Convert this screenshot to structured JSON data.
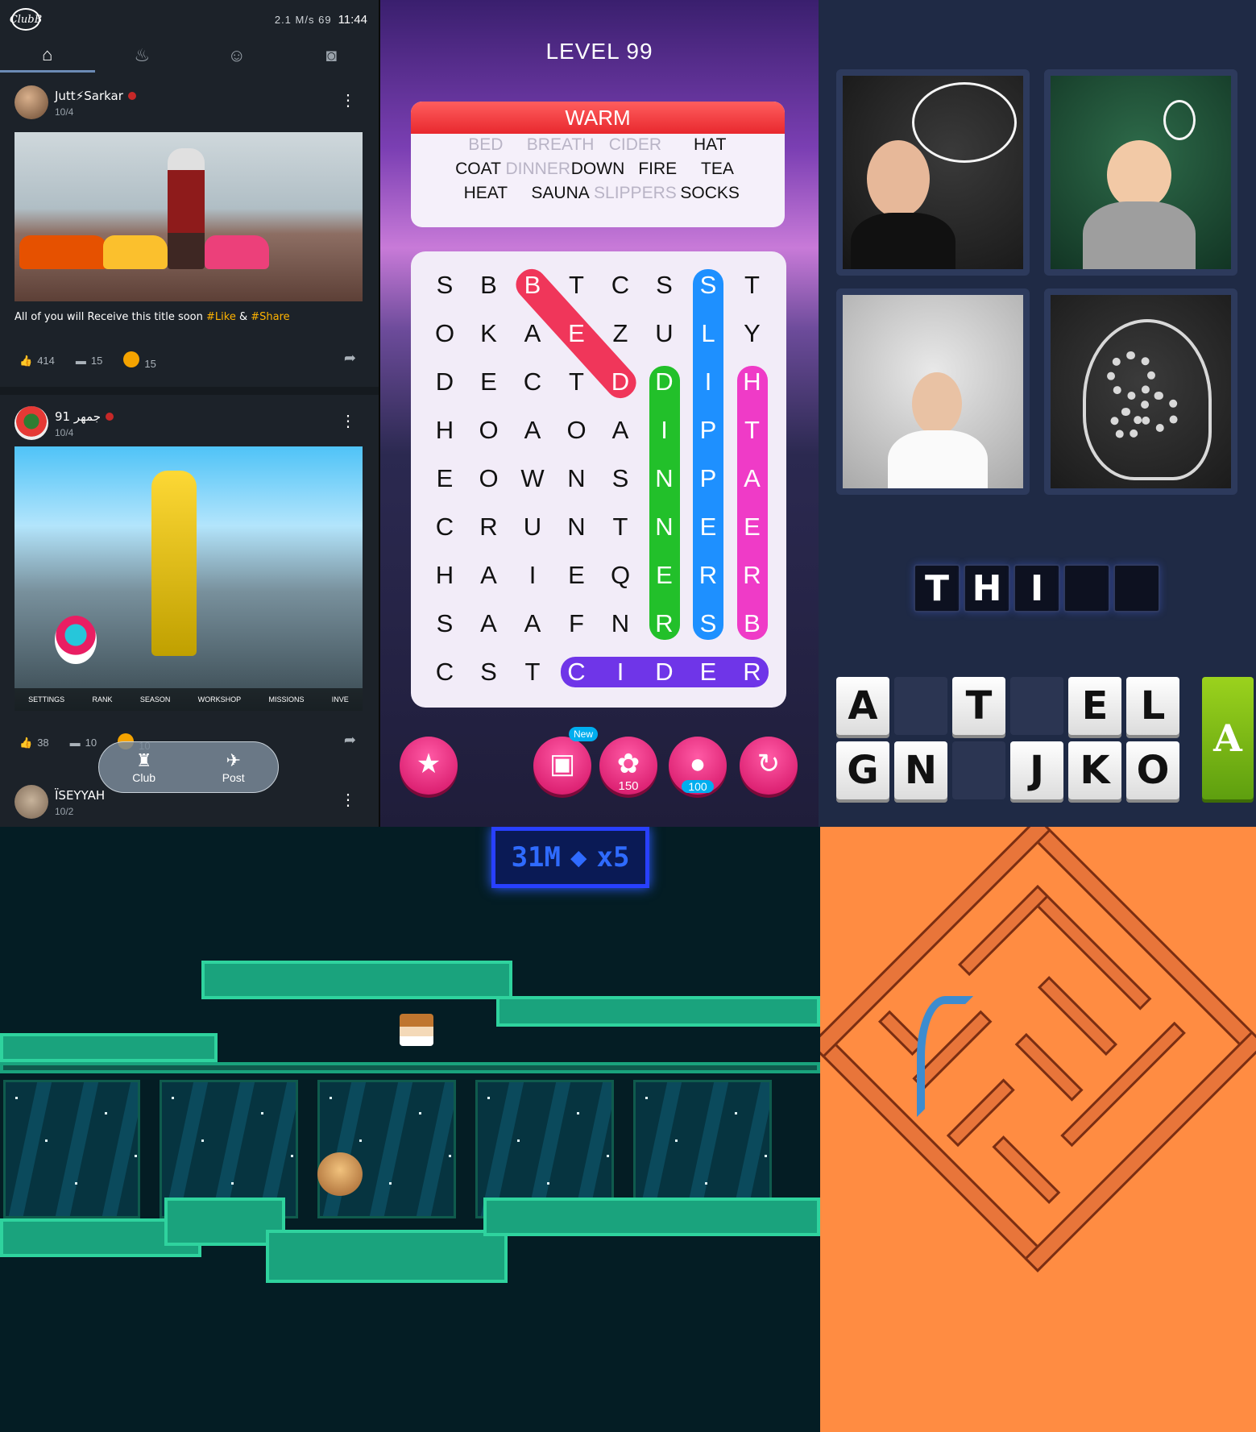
{
  "social": {
    "status": {
      "net_speed": "2.1 M/s",
      "battery": "69",
      "time": "11:44",
      "app_logo": "ClubB"
    },
    "tabs": [
      {
        "icon": "home-icon",
        "glyph": "⌂"
      },
      {
        "icon": "fire-icon",
        "glyph": "♨"
      },
      {
        "icon": "people-icon",
        "glyph": "☺"
      },
      {
        "icon": "camera-icon",
        "glyph": "◙"
      }
    ],
    "posts": [
      {
        "author": "Jutt⚡Sarkar",
        "date": "10/4",
        "caption_main": "All of you will Receive this title soon ",
        "tag1": "#Like",
        "amp": " & ",
        "tag2": "#Share",
        "likes": "414",
        "comments": "15",
        "fires": "15"
      },
      {
        "author": "جمهر 91",
        "date": "10/4",
        "likes": "38",
        "comments": "10",
        "fires": "10",
        "menu": [
          "SETTINGS",
          "RANK",
          "SEASON",
          "WORKSHOP",
          "MISSIONS",
          "INVE"
        ]
      },
      {
        "author": "ÏSEYYAH",
        "date": "10/2"
      }
    ],
    "fab": {
      "club_label": "Club",
      "post_label": "Post"
    }
  },
  "wordsearch": {
    "level": "LEVEL 99",
    "category": "WARM",
    "word_rows": [
      [
        {
          "w": "BED",
          "found": true
        },
        {
          "w": "BREATH",
          "found": true
        },
        {
          "w": "CIDER",
          "found": true
        },
        {
          "w": "HAT",
          "found": false
        }
      ],
      [
        {
          "w": "COAT",
          "found": false
        },
        {
          "w": "DINNER",
          "found": true
        },
        {
          "w": "DOWN",
          "found": false
        },
        {
          "w": "FIRE",
          "found": false
        },
        {
          "w": "TEA",
          "found": false
        }
      ],
      [
        {
          "w": "HEAT",
          "found": false
        },
        {
          "w": "SAUNA",
          "found": false
        },
        {
          "w": "SLIPPERS",
          "found": true
        },
        {
          "w": "SOCKS",
          "found": false
        }
      ]
    ],
    "grid": [
      [
        "S",
        "B",
        "B",
        "T",
        "C",
        "S",
        "S",
        "T"
      ],
      [
        "O",
        "K",
        "A",
        "E",
        "Z",
        "U",
        "L",
        "Y"
      ],
      [
        "D",
        "E",
        "C",
        "T",
        "D",
        "D",
        "I",
        "H"
      ],
      [
        "H",
        "O",
        "A",
        "O",
        "A",
        "I",
        "P",
        "T"
      ],
      [
        "E",
        "O",
        "W",
        "N",
        "S",
        "N",
        "P",
        "A"
      ],
      [
        "C",
        "R",
        "U",
        "N",
        "T",
        "N",
        "E",
        "E"
      ],
      [
        "H",
        "A",
        "I",
        "E",
        "Q",
        "E",
        "R",
        "R"
      ],
      [
        "S",
        "A",
        "A",
        "F",
        "N",
        "R",
        "S",
        "B"
      ],
      [
        "C",
        "S",
        "T",
        "C",
        "I",
        "D",
        "E",
        "R"
      ]
    ],
    "tools": {
      "new_badge": "New",
      "fan_count": "150",
      "hint_count": "100"
    }
  },
  "fourpics": {
    "answer": [
      "T",
      "H",
      "I",
      "",
      ""
    ],
    "keys_row1": [
      "A",
      "",
      "T",
      "",
      "E",
      "L"
    ],
    "keys_row2": [
      "G",
      "N",
      "",
      "J",
      "K",
      "O"
    ],
    "hint_glyph": "A"
  },
  "platformer": {
    "distance": "31M",
    "gems": "x5"
  },
  "colors": {
    "wordsearch_red": "#f0365a",
    "wordsearch_green": "#22c02a",
    "wordsearch_blue": "#1e90ff",
    "wordsearch_pink": "#ef3bc7",
    "wordsearch_purple": "#6f35e8",
    "maze_bg": "#ff8c42"
  }
}
